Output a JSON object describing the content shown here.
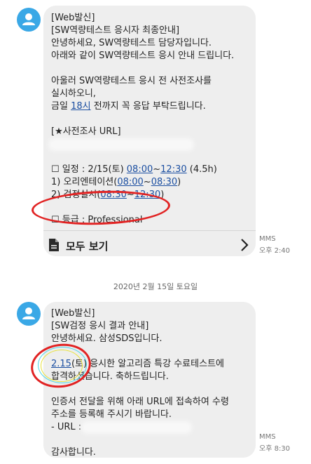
{
  "messages": [
    {
      "lines": [
        [
          "[Web발신]"
        ],
        [
          "[SW역량테스트 응시자 최종안내]"
        ],
        [
          "안녕하세요, SW역량테스트 담당자입니다."
        ],
        [
          "아래와 같이 SW역량테스트 응시 안내 드립니다."
        ],
        [],
        [
          "아울러 SW역량테스트 응시 전 사전조사를"
        ],
        [
          "실시하오니,"
        ],
        [
          "금일 ",
          {
            "link": "18시"
          },
          " 전까지 꼭 응답 부탁드립니다."
        ],
        [],
        [
          "[★사전조사 URL]"
        ],
        [
          {
            "blur": 200
          }
        ],
        [],
        [
          "☐ 일정 : 2/15(토) ",
          {
            "link": "08:00"
          },
          "~",
          {
            "link": "12:30"
          },
          " (4.5h)"
        ],
        [
          " 1) 오리엔테이션(",
          {
            "link": "08:00"
          },
          "~",
          {
            "link": "08:30"
          },
          ")"
        ],
        [
          " 2) 검정실시(",
          {
            "link": "08:30"
          },
          "~",
          {
            "link": "12:30"
          },
          ")"
        ],
        [],
        [
          "☐ 등급 : Professional"
        ]
      ],
      "view_all_label": "모두 보기",
      "type_label": "MMS",
      "time": "오후 2:40"
    },
    {
      "lines": [
        [
          "[Web발신]"
        ],
        [
          "[SW검정 응시 결과 안내]"
        ],
        [
          "안녕하세요. 삼성SDS입니다."
        ],
        [],
        [
          {
            "link": "2.15"
          },
          "(토) 응시한 알고리즘 특강 수료테스트에"
        ],
        [
          "합격하셨습니다. 축하드립니다."
        ],
        [],
        [
          "인증서 전달을 위해 아래 URL에 접속하여 수령"
        ],
        [
          "주소를 등록해 주시기 바랍니다."
        ],
        [
          " - URL : ",
          {
            "blur": 150
          }
        ],
        [],
        [
          "감사합니다."
        ]
      ],
      "type_label": "MMS",
      "time": "오후 8:30"
    }
  ],
  "date_separator": "2020년 2월 15일 토요일",
  "colors": {
    "bubble": "#eeeeee",
    "avatar": "#3aa8e6",
    "link": "#1c4fa1",
    "annotation_red": "#e12323"
  }
}
